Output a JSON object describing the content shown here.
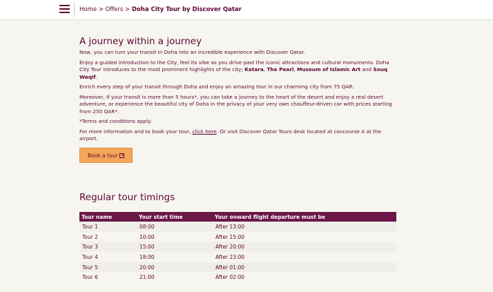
{
  "header": {
    "menu_icon": "hamburger-menu-icon",
    "breadcrumb": {
      "home": "Home",
      "sep1": ">",
      "offers": "Offers",
      "sep2": ">",
      "current": "Doha City Tour by Discover Qatar"
    }
  },
  "main": {
    "title": "A journey within a journey",
    "intro": "Now, you can turn your transit in Doha into an incredible experience with Discover Qatar.",
    "guided": {
      "text": "Enjoy a guided introduction to the City, feel its vibe as you drive past the iconic attractions and cultural monuments. Doha City Tour introduces to the most prominent highlights of the city; ",
      "h1": "Katara",
      "c1": ", ",
      "h2": "The Pearl",
      "c2": ", ",
      "h3": "Museum of Islamic Art",
      "c3": " and ",
      "h4": "Souq Waqif",
      "end": "."
    },
    "enrich": "Enrich every step of your transit through Doha and enjoy an amazing tour in our charming city from 75 QAR.",
    "moreover": "Moreover, If your transit is more than 5 hours*, you can take a journey to the heart of the desert and enjoy a real desert adventure, or experience the beautiful city of Doha in the privacy of your very own chauffeur-driven car with prices starting from 250 QAR*.",
    "terms": "*Terms and conditions apply.",
    "more_info": {
      "before": "For more information and to book your tour, ",
      "link": "click here",
      "after": ". Or visit Discover Qatar Tours desk located at concourse A at the airport."
    },
    "book_button": "Book a tour",
    "book_icon": "external-link-icon"
  },
  "timings": {
    "title": "Regular tour timings",
    "columns": [
      "Tour name",
      "Your start time",
      "Your onward flight departure must be"
    ],
    "rows": [
      [
        "Tour 1",
        "08:00",
        "After 13:00"
      ],
      [
        "Tour 2",
        "10:00",
        "After 15:00"
      ],
      [
        "Tour 3",
        "15:00",
        "After 20:00"
      ],
      [
        "Tour 4",
        "18:00",
        "After 23:00"
      ],
      [
        "Tour 5",
        "20:00",
        "After 01:00"
      ],
      [
        "Tour 6",
        "21:00",
        "After 02:00"
      ]
    ]
  },
  "colors": {
    "brand": "#5c0632",
    "table_header": "#6b1748",
    "button": "#f4a65a",
    "background": "#f6f5f0"
  }
}
